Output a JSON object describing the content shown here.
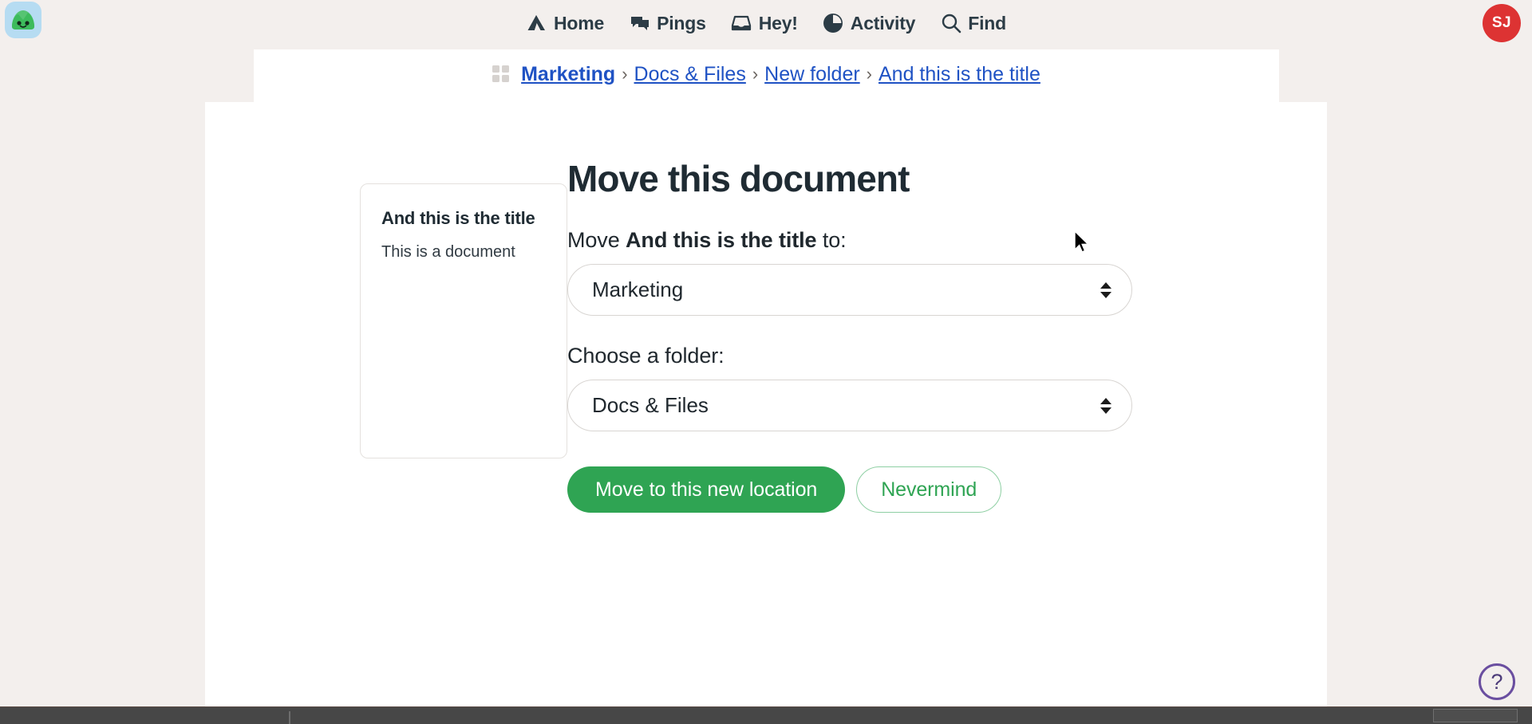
{
  "app": {
    "logo_icon": "basecamp-blob-logo"
  },
  "nav": {
    "items": [
      {
        "label": "Home",
        "icon": "home-tent-icon"
      },
      {
        "label": "Pings",
        "icon": "chat-bubbles-icon"
      },
      {
        "label": "Hey!",
        "icon": "inbox-tray-icon"
      },
      {
        "label": "Activity",
        "icon": "pie-clock-icon"
      },
      {
        "label": "Find",
        "icon": "magnifier-icon"
      }
    ],
    "avatar_initials": "SJ",
    "avatar_color": "#dd3333"
  },
  "breadcrumb": {
    "grid_icon": "grid-2x2-icon",
    "separator": "›",
    "items": [
      {
        "label": "Marketing"
      },
      {
        "label": "Docs & Files"
      },
      {
        "label": "New folder"
      },
      {
        "label": "And this is the title"
      }
    ]
  },
  "doc_preview": {
    "title": "And this is the title",
    "body": "This is a document"
  },
  "modal": {
    "title": "Move this document",
    "move_prefix": "Move ",
    "move_target": "And this is the title",
    "move_suffix": " to:",
    "project_select": {
      "value": "Marketing",
      "options": [
        "Marketing"
      ]
    },
    "folder_label": "Choose a folder:",
    "folder_select": {
      "value": "Docs & Files",
      "options": [
        "Docs & Files"
      ]
    },
    "primary_button": "Move to this new location",
    "secondary_button": "Nevermind",
    "primary_color": "#2fa453"
  },
  "help": {
    "label": "?",
    "icon": "question-mark-circle-icon",
    "color": "#6a4ea0"
  }
}
